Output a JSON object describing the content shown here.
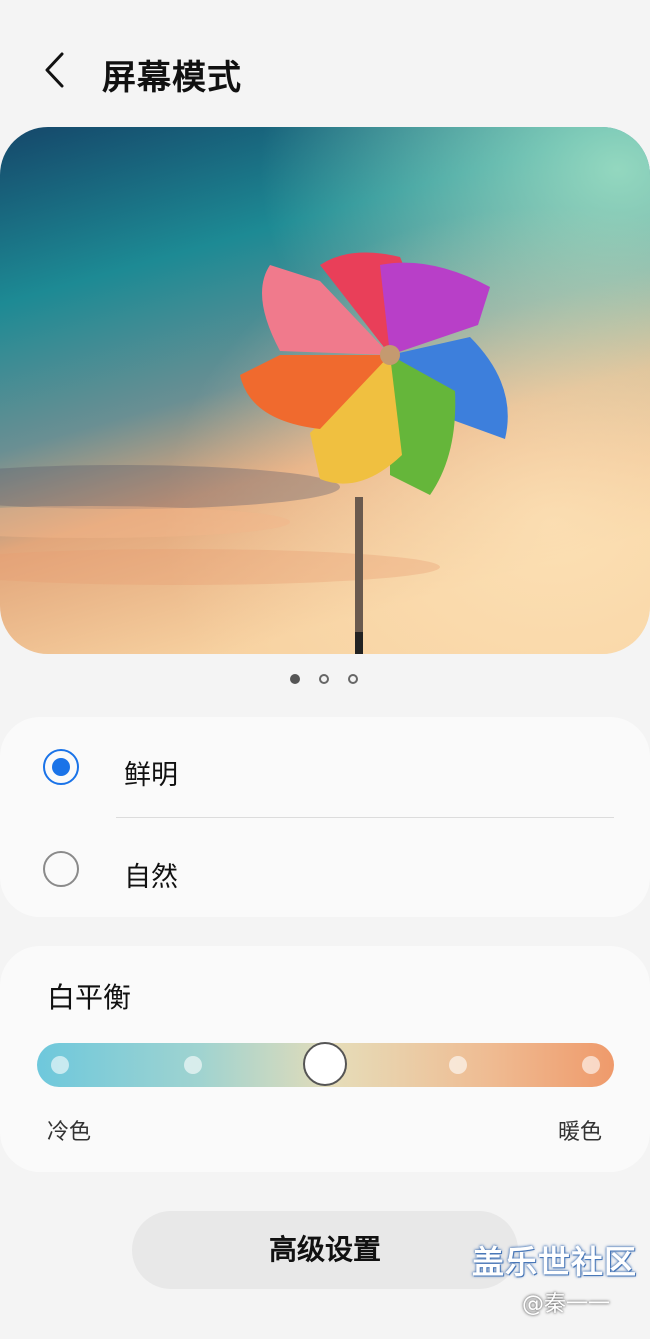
{
  "header": {
    "title": "屏幕模式",
    "back_icon": "chevron-left-icon"
  },
  "preview": {
    "image": "pinwheel-photo",
    "page_count": 3,
    "active_page": 1
  },
  "screen_mode": {
    "options": [
      {
        "label": "鲜明",
        "selected": true
      },
      {
        "label": "自然",
        "selected": false
      }
    ]
  },
  "white_balance": {
    "title": "白平衡",
    "cold_label": "冷色",
    "warm_label": "暖色",
    "steps": 5,
    "value_step": 3
  },
  "advanced_button": {
    "label": "高级设置"
  },
  "watermark": {
    "main": "盖乐世社区",
    "sub": "@秦一一"
  },
  "colors": {
    "accent": "#1a73e8",
    "background": "#f4f4f4",
    "card": "#fafafa"
  }
}
